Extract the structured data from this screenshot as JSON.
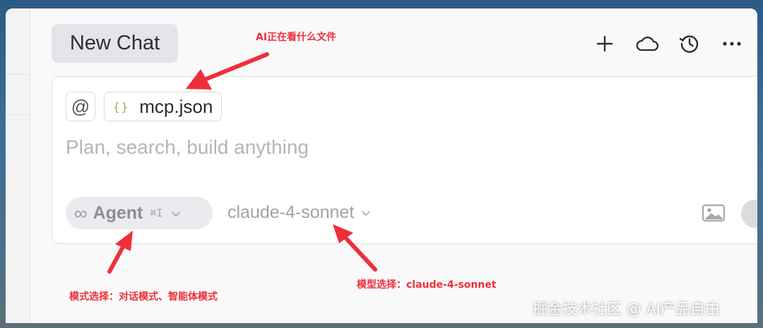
{
  "header": {
    "chat_tab_label": "New Chat",
    "icons": [
      "plus-icon",
      "cloud-icon",
      "history-icon",
      "more-icon"
    ]
  },
  "composer": {
    "mention_symbol": "@",
    "attached_file": {
      "icon_text": "{}",
      "name": "mcp.json"
    },
    "placeholder": "Plan, search, build anything",
    "mode": {
      "icon": "∞",
      "label": "Agent",
      "shortcut": "⌘I"
    },
    "model": "claude-4-sonnet"
  },
  "annotations": {
    "file_note": "AI正在看什么文件",
    "mode_note": "模式选择：对话模式、智能体模式",
    "model_note": "模型选择：claude-4-sonnet",
    "color": "#ee2f3a"
  },
  "watermark": "掘金技术社区 @ AI产品自由"
}
